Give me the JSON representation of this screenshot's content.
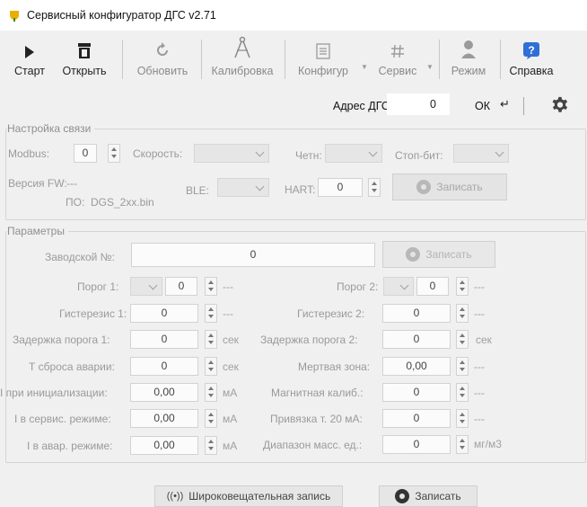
{
  "window": {
    "title": "Сервисный конфигуратор ДГС v2.71"
  },
  "toolbar": {
    "start": "Старт",
    "open": "Открыть",
    "refresh": "Обновить",
    "calibration": "Калибровка",
    "config": "Конфигур",
    "service": "Сервис",
    "mode": "Режим",
    "help": "Справка"
  },
  "address": {
    "label": "Адрес ДГС:",
    "value": "0",
    "ok": "ОК",
    "enter_symbol": "↵"
  },
  "connection": {
    "title": "Настройка связи",
    "modbus_label": "Modbus:",
    "modbus_value": "0",
    "speed_label": "Скорость:",
    "parity_label": "Четн:",
    "stopbit_label": "Стоп-бит:",
    "fw_label": "Версия FW:",
    "fw_value": "---",
    "po_label": "ПО:",
    "po_value": "DGS_2xx.bin",
    "ble_label": "BLE:",
    "hart_label": "HART:",
    "hart_value": "0",
    "write_label": "Записать"
  },
  "params": {
    "title": "Параметры",
    "serial_label": "Заводской №:",
    "serial_value": "0",
    "write_label": "Записать",
    "thr1_label": "Порог 1:",
    "thr1_value": "0",
    "thr1_unit": "---",
    "thr2_label": "Порог 2:",
    "thr2_value": "0",
    "thr2_unit": "---",
    "hyst1_label": "Гистерезис 1:",
    "hyst1_value": "0",
    "hyst1_unit": "---",
    "hyst2_label": "Гистерезис 2:",
    "hyst2_value": "0",
    "hyst2_unit": "---",
    "delay1_label": "Задержка порога 1:",
    "delay1_value": "0",
    "delay1_unit": "сек",
    "delay2_label": "Задержка порога 2:",
    "delay2_value": "0",
    "delay2_unit": "сек",
    "reset_label": "Т сброса аварии:",
    "reset_value": "0",
    "reset_unit": "сек",
    "dead_label": "Мертвая зона:",
    "dead_value": "0,00",
    "dead_unit": "---",
    "iinit_label": "I при инициализации:",
    "iinit_value": "0,00",
    "iinit_unit": "мА",
    "magcal_label": "Магнитная калиб.:",
    "magcal_value": "0",
    "magcal_unit": "---",
    "iserv_label": "I в сервис. режиме:",
    "iserv_value": "0,00",
    "iserv_unit": "мА",
    "bind20_label": "Привязка т. 20 мА:",
    "bind20_value": "0",
    "bind20_unit": "---",
    "ialarm_label": "I в авар. режиме:",
    "ialarm_value": "0,00",
    "ialarm_unit": "мА",
    "range_label": "Диапазон масс. ед.:",
    "range_value": "0",
    "range_unit": "мг/м3"
  },
  "bottom": {
    "broadcast": "Широковещательная запись",
    "write": "Записать"
  },
  "colors": {
    "help_icon": "#2f6fd6",
    "accent_dot": "#e8b000"
  }
}
